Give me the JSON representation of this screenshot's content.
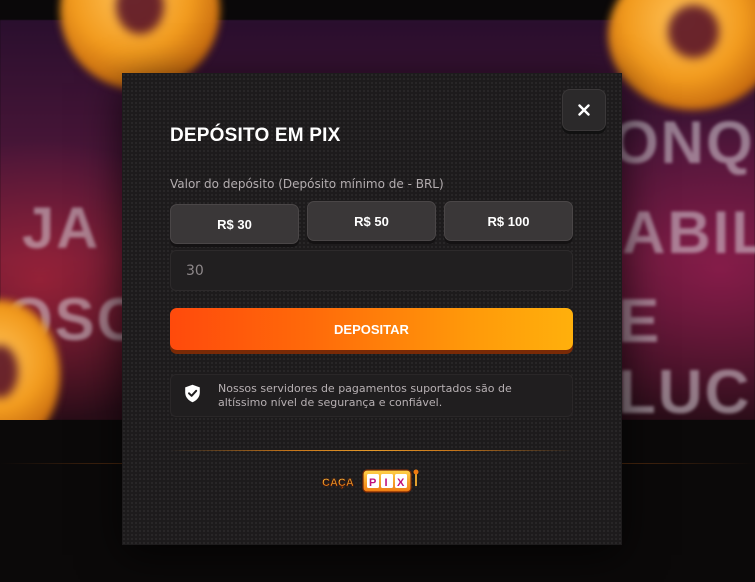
{
  "modal": {
    "title": "DEPÓSITO EM PIX",
    "deposit_label": "Valor do depósito (Depósito mínimo de - BRL)",
    "amount_options": [
      "R$ 30",
      "R$ 50",
      "R$ 100"
    ],
    "amount_value": "30",
    "deposit_button": "DEPOSITAR",
    "security_text": "Nossos servidores de pagamentos suportados são de altíssimo nível de segurança e confiável.",
    "close_icon": "close-icon",
    "shield_icon": "shield-check-icon",
    "logo_text": [
      "CAÇA",
      "PIX"
    ]
  },
  "background": {
    "banner_text": [
      "JA",
      "OSO",
      "ONQ",
      "ABIL",
      "E LUC"
    ]
  },
  "colors": {
    "accent_start": "#ff4a0c",
    "accent_end": "#ffb00c",
    "modal_bg": "#1d1b1c",
    "button_bg": "#3a3738"
  }
}
